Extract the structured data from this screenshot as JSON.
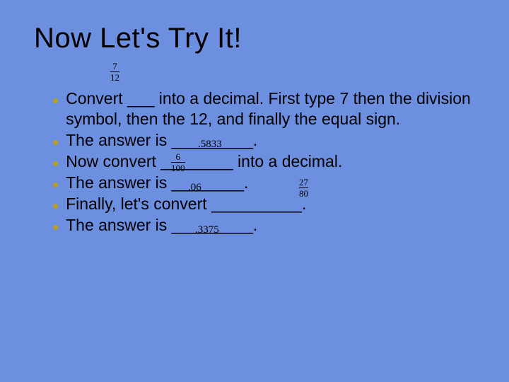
{
  "title": "Now Let's Try It!",
  "bullets": [
    "Convert ___ into a decimal.  First type 7 then the division symbol, then the 12, and finally the equal sign.",
    " The answer is _________.",
    "Now convert ________ into a decimal.",
    "The answer is ________.",
    "Finally, let's convert __________.",
    "The answer is _________."
  ],
  "fractions": {
    "f1": {
      "num": "7",
      "den": "12"
    },
    "f2": {
      "num": "6",
      "den": "100"
    },
    "f3": {
      "num": "27",
      "den": "80"
    }
  },
  "overlays": {
    "ans1": ".5833",
    "mid1": ".06",
    "ans3": ".3375"
  }
}
